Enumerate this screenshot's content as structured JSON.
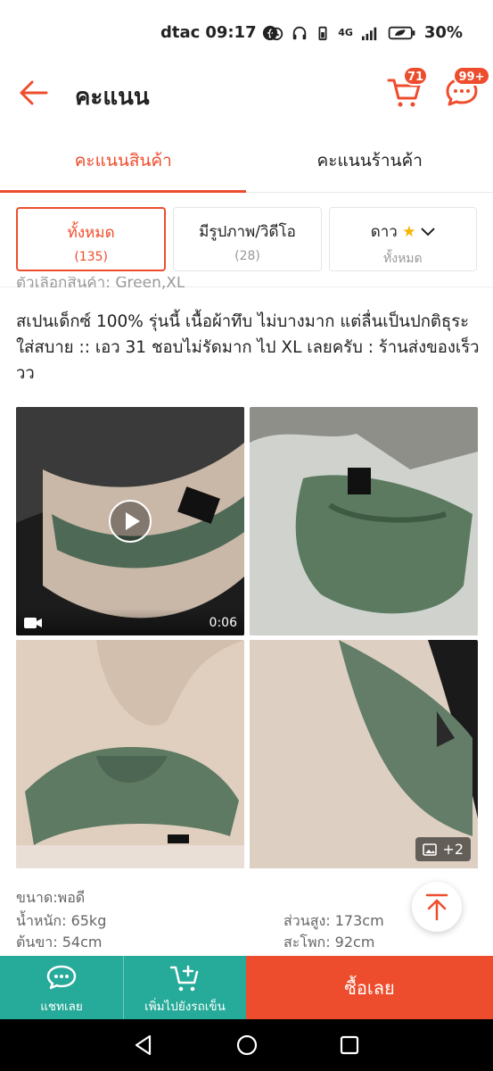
{
  "status": {
    "carrier": "dtac",
    "time": "09:17",
    "network": "4G",
    "battery": "30%"
  },
  "header": {
    "title": "คะแนน",
    "cart_badge": "71",
    "chat_badge": "99+"
  },
  "tabs": [
    {
      "label": "คะแนนสินค้า",
      "active": true
    },
    {
      "label": "คะแนนร้านค้า",
      "active": false
    }
  ],
  "filters": [
    {
      "label": "ทั้งหมด",
      "sub": "(135)",
      "active": true
    },
    {
      "label": "มีรูปภาพ/วิดีโอ",
      "sub": "(28)",
      "active": false
    },
    {
      "label": "ดาว",
      "sub": "ทั้งหมด",
      "active": false
    }
  ],
  "review": {
    "variation": "ตัวเลือกสินค้า: Green,XL",
    "text": "สเปนเด็กซ์ 100% รุ่นนี้ เนื้อผ้าทึบ ไม่บางมาก แต่ลื่นเป็นปกติธุระ ใส่สบาย :: เอว 31 ชอบไม่รัดมาก ไป XL เลยครับ : ร้านส่งของเร็ววว",
    "video_duration": "0:06",
    "more_media": "+2",
    "size": "ขนาด:พอดี",
    "weight": "น้ำหนัก: 65kg",
    "height": "ส่วนสูง: 173cm",
    "thigh": "ต้นขา: 54cm",
    "hip": "สะโพก: 92cm"
  },
  "actions": {
    "chat": "แชทเลย",
    "add_cart": "เพิ่มไปยังรถเข็น",
    "buy": "ซื้อเลย"
  },
  "colors": {
    "accent": "#ee4d2d",
    "teal": "#26aa99",
    "star": "#f5b300"
  }
}
